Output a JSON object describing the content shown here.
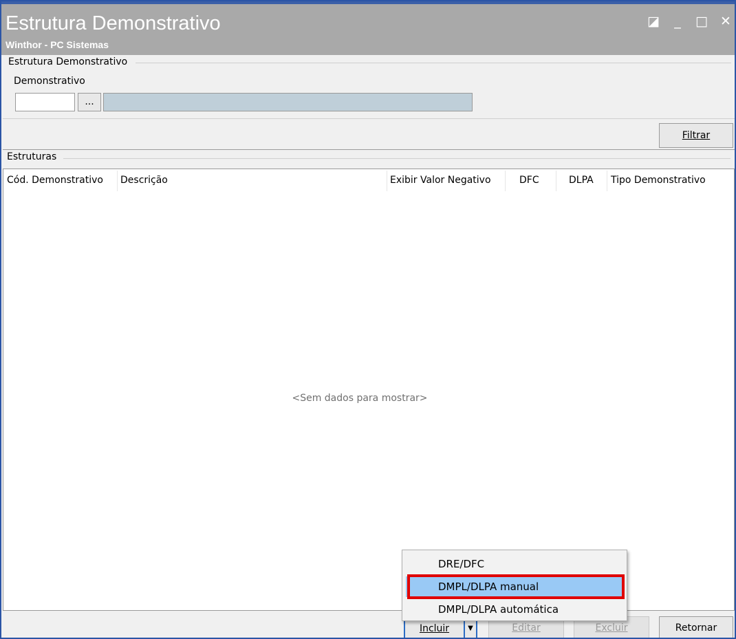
{
  "window": {
    "title": "Estrutura Demonstrativo",
    "subtitle": "Winthor - PC Sistemas",
    "restore_icon": "◪",
    "min_icon": "_",
    "max_icon": "□",
    "close_icon": "✕"
  },
  "filter_group": {
    "legend": "Estrutura Demonstrativo",
    "field_label": "Demonstrativo",
    "code_value": "",
    "ellipsis_label": "...",
    "description_value": "",
    "filter_button": "Filtrar"
  },
  "grid": {
    "legend": "Estruturas",
    "columns": [
      "Cód. Demonstrativo",
      "Descrição",
      "Exibir Valor Negativo",
      "DFC",
      "DLPA",
      "Tipo Demonstrativo"
    ],
    "empty_text": "<Sem dados para mostrar>"
  },
  "footer": {
    "incluir": "Incluir",
    "dropdown_arrow": "▼",
    "editar": "Editar",
    "excluir": "Excluir",
    "retornar": "Retornar"
  },
  "include_menu": {
    "items": [
      "DRE/DFC",
      "DMPL/DLPA manual",
      "DMPL/DLPA automática"
    ],
    "highlighted": "DMPL/DLPA manual"
  },
  "colors": {
    "title_bar": "#a9a9a9",
    "window_border": "#2b55a6",
    "menu_selected": "#99c9f5",
    "annotation": "#e00000"
  }
}
